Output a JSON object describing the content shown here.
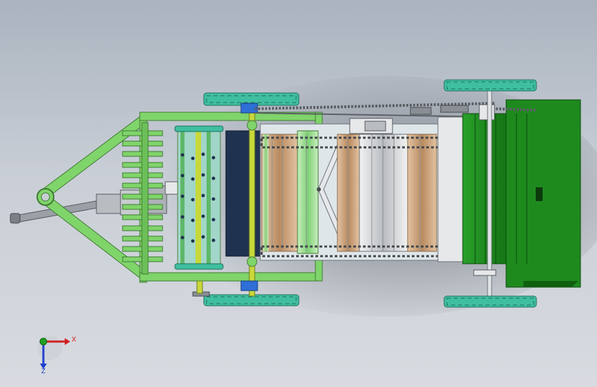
{
  "viewport": {
    "background_top": "#aab3bf",
    "background_bottom": "#d8dbe0"
  },
  "model": {
    "frame_color": "#7fd46a",
    "frame_edge": "#3f7a33",
    "wheel_color": "#3fbfa0",
    "wheel_edge": "#1f6f5c",
    "roller_tan": "#c9a079",
    "roller_green": "#8fcf86",
    "bale_chamber_green": "#1e8a1e",
    "bale_chamber_dark": "#136b13",
    "cover_dark": "#1f3350",
    "hitch_grey": "#8a8f96",
    "bearing_blue": "#2f6fd6",
    "chain_grey": "#5c6066"
  },
  "triad": {
    "x_label": "X",
    "z_label": "Z",
    "x_color": "#d02020",
    "y_color": "#20a020",
    "z_color": "#2040d0"
  }
}
